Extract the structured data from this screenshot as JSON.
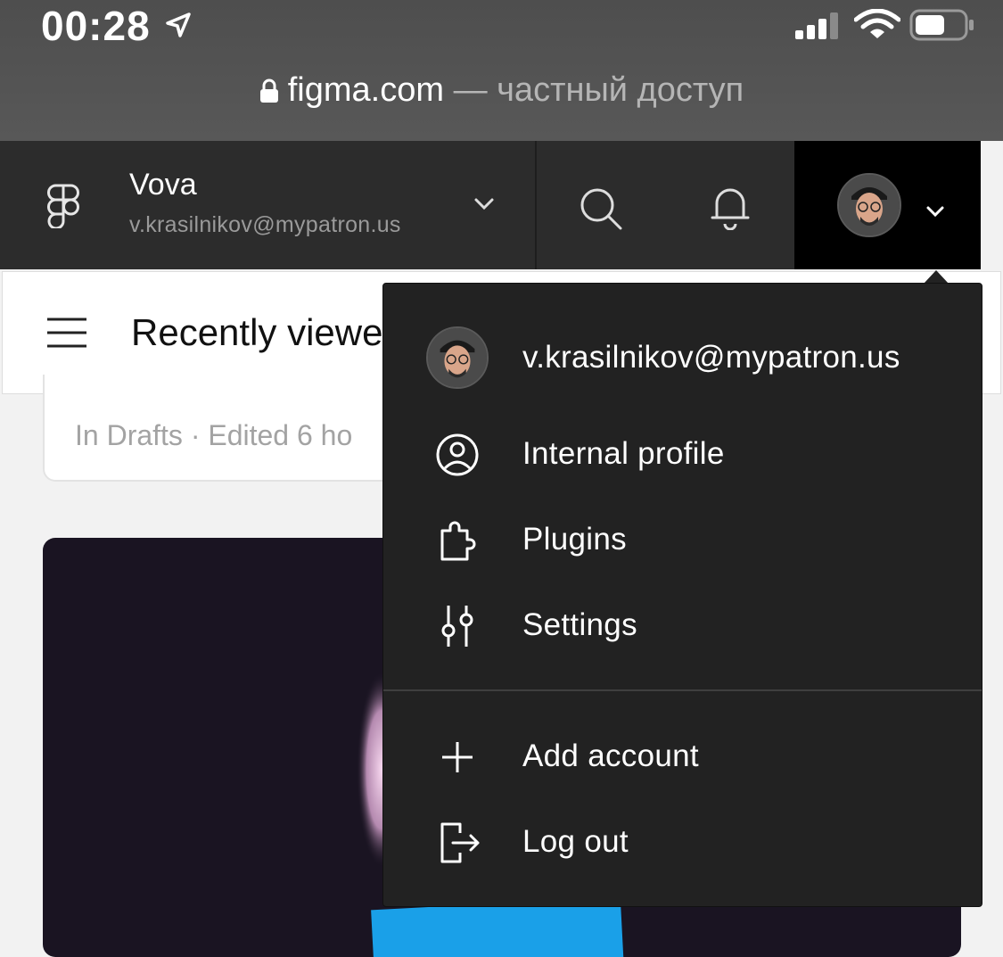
{
  "status_bar": {
    "time": "00:28",
    "icons": [
      "location-arrow-icon",
      "cellular-signal-icon",
      "wifi-icon",
      "battery-icon"
    ]
  },
  "browser": {
    "domain": "figma.com",
    "suffix": " — частный доступ"
  },
  "header": {
    "team_name": "Vova",
    "team_email": "v.krasilnikov@mypatron.us"
  },
  "page": {
    "title": "Recently viewe",
    "file_meta": "In Drafts · Edited 6 ho"
  },
  "account_menu": {
    "email": "v.krasilnikov@mypatron.us",
    "items": [
      {
        "label": "Internal profile",
        "icon": "profile-icon"
      },
      {
        "label": "Plugins",
        "icon": "plugin-puzzle-icon"
      },
      {
        "label": "Settings",
        "icon": "sliders-icon"
      }
    ],
    "footer_items": [
      {
        "label": "Add account",
        "icon": "plus-icon"
      },
      {
        "label": "Log out",
        "icon": "logout-icon"
      }
    ]
  },
  "colors": {
    "header_bg": "#2c2c2c",
    "menu_bg": "#222222",
    "account_button_bg": "#000000"
  }
}
